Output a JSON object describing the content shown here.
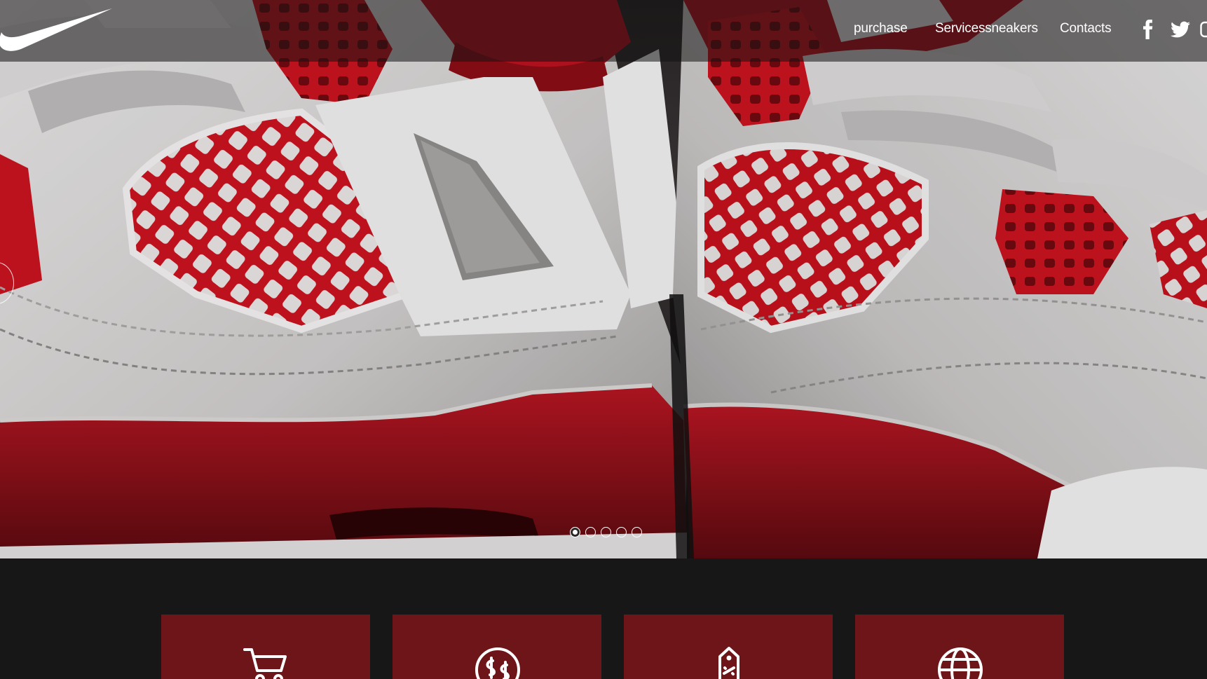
{
  "header": {
    "brand": "Nike",
    "nav": [
      {
        "label": "purchase"
      },
      {
        "label": "Servicessneakers"
      },
      {
        "label": "Contacts"
      }
    ],
    "social": [
      {
        "icon": "facebook-icon"
      },
      {
        "icon": "twitter-icon"
      }
    ]
  },
  "hero": {
    "image_subject": "red and white sneakers close-up",
    "slides_total": 5,
    "active_slide": 1
  },
  "features": [
    {
      "icon": "shopping-cart-icon"
    },
    {
      "icon": "currency-exchange-icon"
    },
    {
      "icon": "price-tag-icon"
    },
    {
      "icon": "globe-icon"
    }
  ],
  "colors": {
    "accent": "#6d1518",
    "page_background": "#181718",
    "text": "#ffffff"
  }
}
